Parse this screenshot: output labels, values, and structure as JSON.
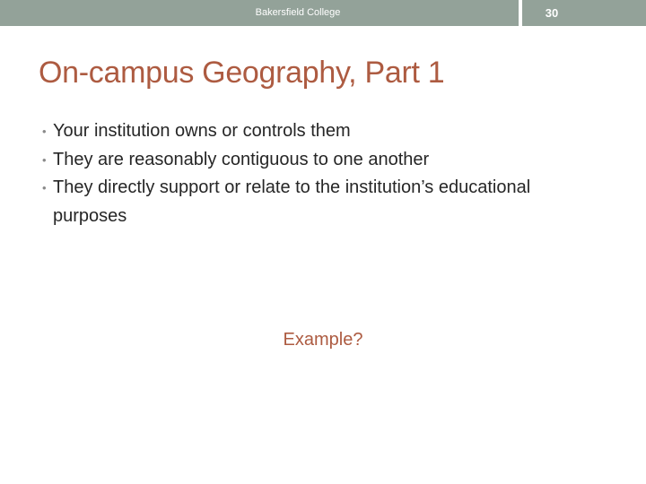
{
  "header": {
    "title": "Bakersfield College",
    "page_number": "30"
  },
  "slide": {
    "title": "On-campus Geography, Part 1",
    "bullet_marker": "•",
    "bullets": [
      "Your institution owns or controls them",
      "They are reasonably contiguous to one another",
      "They directly support or relate to the institution’s educational purposes"
    ],
    "example": "Example?"
  },
  "colors": {
    "header_band": "#93a299",
    "title": "#ad5b41",
    "body_text": "#262626"
  }
}
